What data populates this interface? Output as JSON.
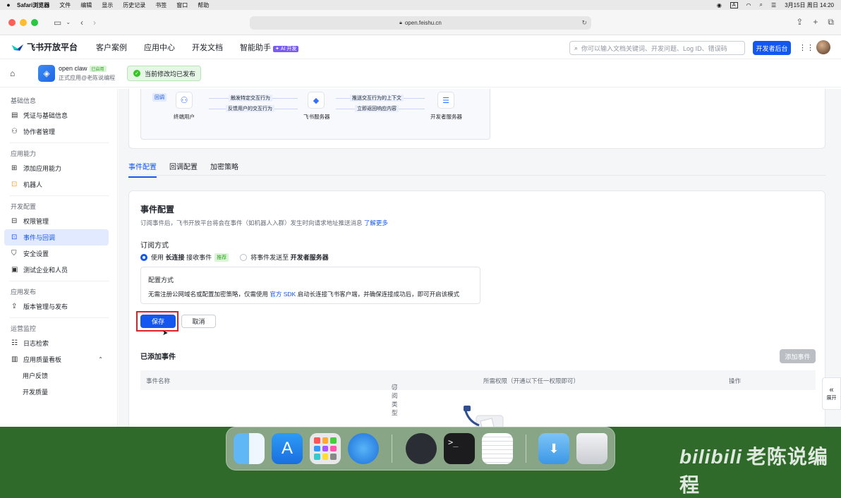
{
  "menubar": {
    "app": "Safari浏览器",
    "items": [
      "文件",
      "编辑",
      "显示",
      "历史记录",
      "书签",
      "窗口",
      "帮助"
    ],
    "input_indicator": "A",
    "datetime": "3月15日 周日 14:20"
  },
  "browser": {
    "url": "open.feishu.cn"
  },
  "topnav": {
    "brand": "飞书开放平台",
    "items": [
      "客户案例",
      "应用中心",
      "开发文档",
      "智能助手"
    ],
    "ai_badge": "✦ AI 开发",
    "search_placeholder": "你可以输入文档关键词、开发问题、Log ID、错误码",
    "dev_console": "开发者后台"
  },
  "app": {
    "name": "open claw",
    "status": "已启用",
    "subtitle": "正式应用@老陈说编程",
    "toast": "当前修改均已发布"
  },
  "sidebar": {
    "groups": [
      {
        "title": "基础信息",
        "items": [
          {
            "label": "凭证与基础信息",
            "icon": "credential-icon"
          },
          {
            "label": "协作者管理",
            "icon": "user-icon"
          }
        ]
      },
      {
        "title": "应用能力",
        "items": [
          {
            "label": "添加应用能力",
            "icon": "grid-plus-icon"
          },
          {
            "label": "机器人",
            "icon": "robot-icon"
          }
        ]
      },
      {
        "title": "开发配置",
        "items": [
          {
            "label": "权限管理",
            "icon": "key-icon"
          },
          {
            "label": "事件与回调",
            "icon": "event-icon",
            "active": true
          },
          {
            "label": "安全设置",
            "icon": "shield-icon"
          },
          {
            "label": "测试企业和人员",
            "icon": "test-icon"
          }
        ]
      },
      {
        "title": "应用发布",
        "items": [
          {
            "label": "版本管理与发布",
            "icon": "upload-icon"
          }
        ]
      },
      {
        "title": "运营监控",
        "items": [
          {
            "label": "日志检索",
            "icon": "log-icon"
          },
          {
            "label": "应用质量看板",
            "icon": "chart-icon",
            "expanded": true
          },
          {
            "label": "用户反馈",
            "sub": true
          },
          {
            "label": "开发质量",
            "sub": true
          }
        ]
      }
    ]
  },
  "diagram": {
    "tag": "回调",
    "nodes": [
      "终端用户",
      "飞书服务器",
      "开发者服务器"
    ],
    "arrows": [
      "触发特定交互行为",
      "反馈用户的交互行为",
      "推送交互行为的上下文",
      "立即返回响应内容"
    ]
  },
  "tabs": [
    "事件配置",
    "回调配置",
    "加密策略"
  ],
  "event": {
    "title": "事件配置",
    "desc": "订阅事件后，飞书开放平台将会在事件（如机器人入群）发生时向请求地址推送消息",
    "desc_link": "了解更多",
    "sub_title": "订阅方式",
    "opt1_a": "使用",
    "opt1_b": "长连接",
    "opt1_c": "接收事件",
    "opt1_badge": "推荐",
    "opt2_a": "将事件发送至",
    "opt2_b": "开发者服务器",
    "cfg_title": "配置方式",
    "cfg_desc_a": "无需注册公网域名或配置加密策略，仅需使用",
    "cfg_link": "官方 SDK",
    "cfg_desc_b": "启动长连接飞书客户端，并确保连接成功后，即可开启该模式",
    "save": "保存",
    "cancel": "取消",
    "added_title": "已添加事件",
    "add_btn": "添加事件",
    "columns": [
      "事件名称",
      "订阅类型",
      "所需权限（开通以下任一权限即可）",
      "操作"
    ]
  },
  "expand": "展开",
  "watermark": "老陈说编程",
  "watermark_logo": "bilibili",
  "colors": {
    "primary": "#1456f0",
    "highlight": "#e0212b",
    "success": "#34c724"
  }
}
